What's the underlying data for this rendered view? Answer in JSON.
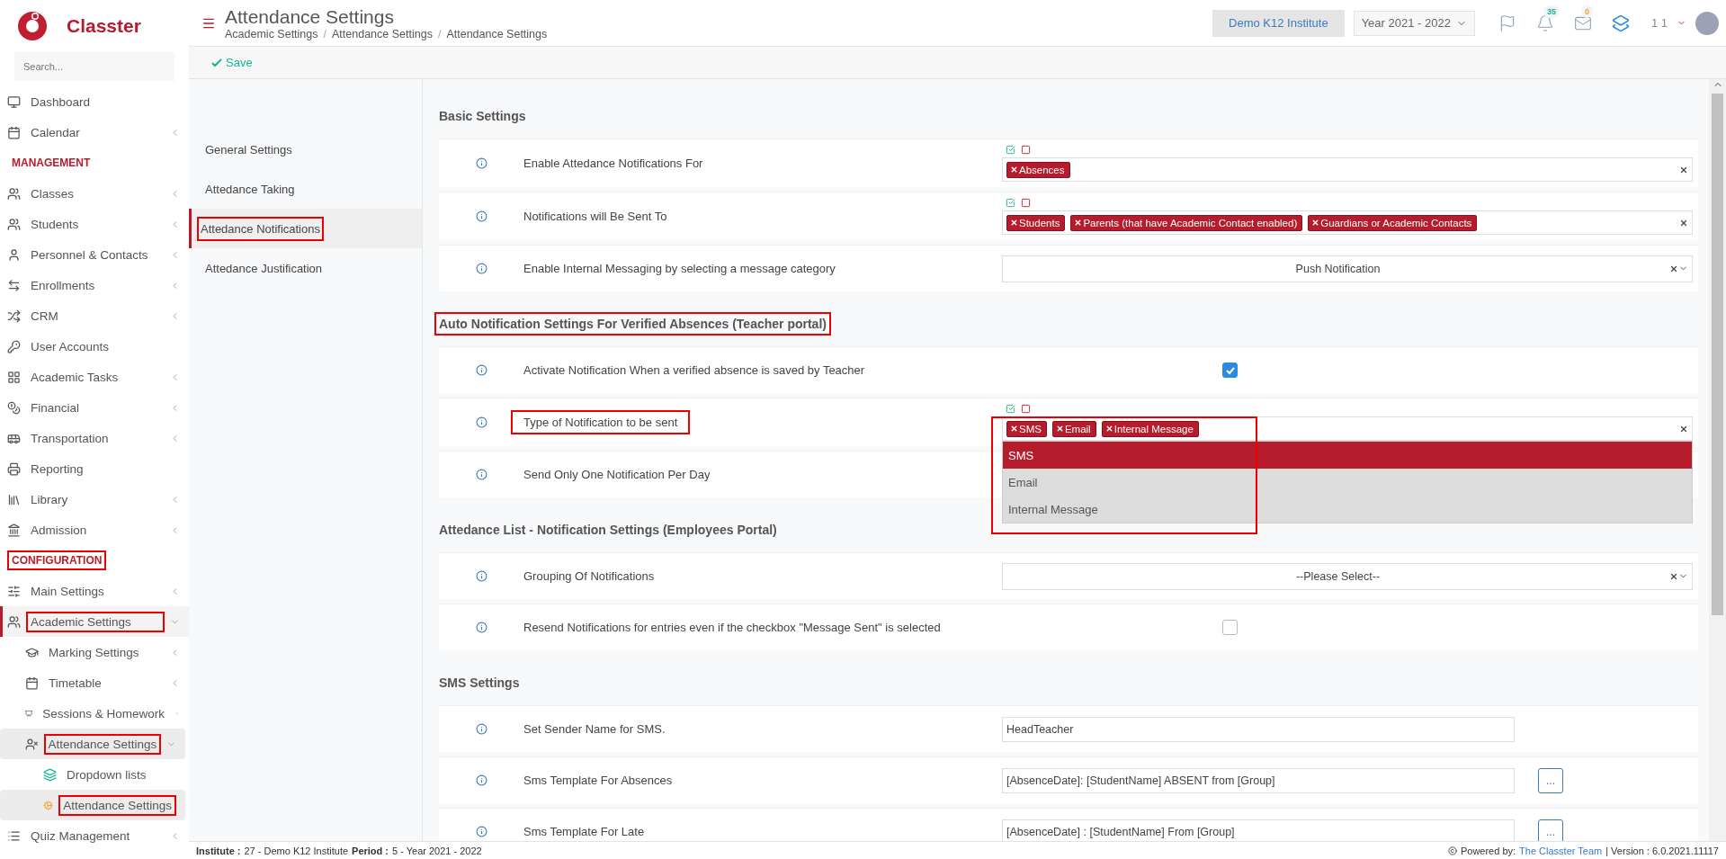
{
  "brand": {
    "name": "Classter"
  },
  "sidebar": {
    "search_placeholder": "Search...",
    "items": [
      {
        "kind": "link",
        "label": "Dashboard",
        "arrow": false,
        "highlighted": false
      },
      {
        "kind": "link",
        "label": "Calendar",
        "arrow": true,
        "highlighted": false
      },
      {
        "kind": "section",
        "label": "MANAGEMENT",
        "highlighted": false
      },
      {
        "kind": "link",
        "label": "Classes",
        "arrow": true,
        "highlighted": false
      },
      {
        "kind": "link",
        "label": "Students",
        "arrow": true,
        "highlighted": false
      },
      {
        "kind": "link",
        "label": "Personnel & Contacts",
        "arrow": true,
        "highlighted": false
      },
      {
        "kind": "link",
        "label": "Enrollments",
        "arrow": true,
        "highlighted": false
      },
      {
        "kind": "link",
        "label": "CRM",
        "arrow": true,
        "highlighted": false
      },
      {
        "kind": "link",
        "label": "User Accounts",
        "arrow": false,
        "highlighted": false
      },
      {
        "kind": "link",
        "label": "Academic Tasks",
        "arrow": true,
        "highlighted": false
      },
      {
        "kind": "link",
        "label": "Financial",
        "arrow": true,
        "highlighted": false
      },
      {
        "kind": "link",
        "label": "Transportation",
        "arrow": true,
        "highlighted": false
      },
      {
        "kind": "link",
        "label": "Reporting",
        "arrow": false,
        "highlighted": false
      },
      {
        "kind": "link",
        "label": "Library",
        "arrow": true,
        "highlighted": false
      },
      {
        "kind": "link",
        "label": "Admission",
        "arrow": true,
        "highlighted": false
      },
      {
        "kind": "section",
        "label": "CONFIGURATION",
        "highlighted": true
      },
      {
        "kind": "link",
        "label": "Main Settings",
        "arrow": true,
        "highlighted": false
      },
      {
        "kind": "link",
        "label": "Academic Settings",
        "arrow": true,
        "expanded": true,
        "highlighted": true,
        "children": [
          {
            "kind": "link",
            "label": "Marking Settings",
            "arrow": true,
            "highlighted": false
          },
          {
            "kind": "link",
            "label": "Timetable",
            "arrow": true,
            "highlighted": false
          },
          {
            "kind": "link",
            "label": "Sessions & Homework",
            "arrow": true,
            "highlighted": false
          },
          {
            "kind": "link",
            "label": "Attendance Settings",
            "arrow": true,
            "expanded": true,
            "highlighted": true,
            "children": [
              {
                "kind": "link",
                "label": "Dropdown lists",
                "arrow": false,
                "highlighted": false
              },
              {
                "kind": "link",
                "label": "Attendance Settings",
                "arrow": false,
                "selected": true,
                "highlighted": true
              }
            ]
          }
        ]
      },
      {
        "kind": "link",
        "label": "Quiz Management",
        "arrow": true,
        "highlighted": false
      }
    ]
  },
  "header": {
    "title": "Attendance Settings",
    "breadcrumbs": [
      "Academic Settings",
      "Attendance Settings",
      "Attendance Settings"
    ],
    "separator": "/",
    "institute": "Demo K12 Institute",
    "year": "Year 2021 - 2022",
    "notifications": "35",
    "messages": "0",
    "user": "1 1"
  },
  "toolbar": {
    "save": "Save"
  },
  "subnav": [
    {
      "label": "General Settings",
      "selected": false,
      "highlighted": false
    },
    {
      "label": "Attedance Taking",
      "selected": false,
      "highlighted": false
    },
    {
      "label": "Attedance Notifications",
      "selected": true,
      "highlighted": true
    },
    {
      "label": "Attedance Justification",
      "selected": false,
      "highlighted": false
    }
  ],
  "sections": [
    {
      "title": "Basic Settings",
      "highlighted": false,
      "rows": [
        {
          "kind": "tags",
          "label": "Enable Attedance Notifications For",
          "highlighted": false,
          "tags": [
            "Absences"
          ]
        },
        {
          "kind": "tags",
          "label": "Notifications will Be Sent To",
          "highlighted": false,
          "tags": [
            "Students",
            "Parents (that have Academic Contact enabled)",
            "Guardians or Academic Contacts"
          ]
        },
        {
          "kind": "select",
          "label": "Enable Internal Messaging by selecting a message category",
          "highlighted": false,
          "value": "Push Notification"
        }
      ]
    },
    {
      "title": "Auto Notification Settings For Verified Absences (Teacher portal)",
      "highlighted": true,
      "rows": [
        {
          "kind": "checkbox",
          "label": "Activate Notification When a verified absence is saved by Teacher",
          "highlighted": false,
          "checked": true
        },
        {
          "kind": "tags",
          "label": "Type of Notification to be sent",
          "highlighted": true,
          "tags": [
            "SMS",
            "Email",
            "Internal Message"
          ],
          "dropdown": [
            {
              "label": "SMS",
              "selected": true
            },
            {
              "label": "Email",
              "selected": false
            },
            {
              "label": "Internal Message",
              "selected": false
            }
          ]
        },
        {
          "kind": "hidden",
          "label": "Send Only One Notification Per Day",
          "highlighted": false
        }
      ]
    },
    {
      "title": "Attedance List - Notification Settings (Employees Portal)",
      "highlighted": false,
      "rows": [
        {
          "kind": "select",
          "label": "Grouping Of Notifications",
          "highlighted": false,
          "value": "--Please Select--"
        },
        {
          "kind": "checkbox",
          "label": "Resend Notifications for entries even if the checkbox \"Message Sent\" is selected",
          "highlighted": false,
          "checked": false
        }
      ]
    },
    {
      "title": "SMS Settings",
      "highlighted": false,
      "rows": [
        {
          "kind": "text",
          "label": "Set Sender Name for SMS.",
          "highlighted": false,
          "value": "HeadTeacher"
        },
        {
          "kind": "template",
          "label": "Sms Template For Absences",
          "highlighted": false,
          "value": "[AbsenceDate]: [StudentName] ABSENT from [Group]",
          "button": "..."
        },
        {
          "kind": "template",
          "label": "Sms Template For Late",
          "highlighted": false,
          "value": "[AbsenceDate] : [StudentName] From [Group]",
          "button": "..."
        }
      ]
    }
  ],
  "footer": {
    "institute_label": "Institute :",
    "institute": "27 - Demo K12 Institute",
    "period_label": "Period :",
    "period": "5 - Year 2021 - 2022",
    "powered": "Powered by:",
    "team": "The Classter Team",
    "version": "| Version : 6.0.2021.11117"
  }
}
